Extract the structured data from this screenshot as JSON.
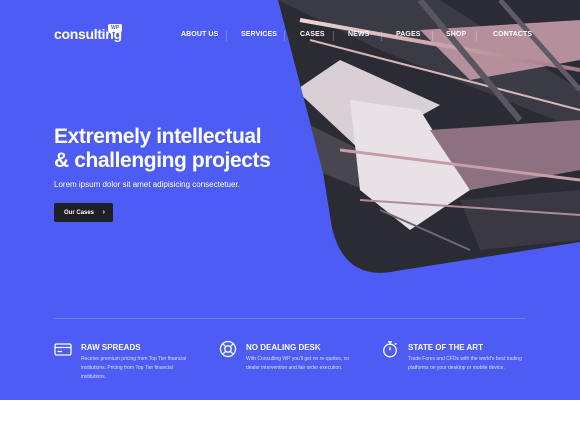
{
  "brand": {
    "name": "consulting",
    "badge": "WP"
  },
  "nav": [
    {
      "label": "ABOUT US"
    },
    {
      "label": "SERVICES"
    },
    {
      "label": "CASES"
    },
    {
      "label": "NEWS"
    },
    {
      "label": "PAGES"
    },
    {
      "label": "SHOP"
    },
    {
      "label": "CONTACTS"
    }
  ],
  "hero": {
    "title_line1": "Extremely intellectual",
    "title_line2": "& challenging projects",
    "subtitle": "Lorem ipsum dolor sit amet adipisicing consectetuer.",
    "cta_label": "Our Cases"
  },
  "features": [
    {
      "icon": "credit-card-icon",
      "title": "RAW SPREADS",
      "desc": "Receive premium pricing from Top Tier financial institutions. Pricing from Top Tier financial institutions."
    },
    {
      "icon": "life-ring-icon",
      "title": "NO DEALING DESK",
      "desc": "With Consulting WP you'll get no re-quotes, no dealer intervention and fair order execution."
    },
    {
      "icon": "stopwatch-icon",
      "title": "STATE OF THE ART",
      "desc": "Trade Forex and CFDs with the world's best trading platforms on your desktop or mobile device."
    }
  ],
  "colors": {
    "accent": "#4d5cf5",
    "dark": "#1f1f26",
    "white": "#ffffff"
  }
}
